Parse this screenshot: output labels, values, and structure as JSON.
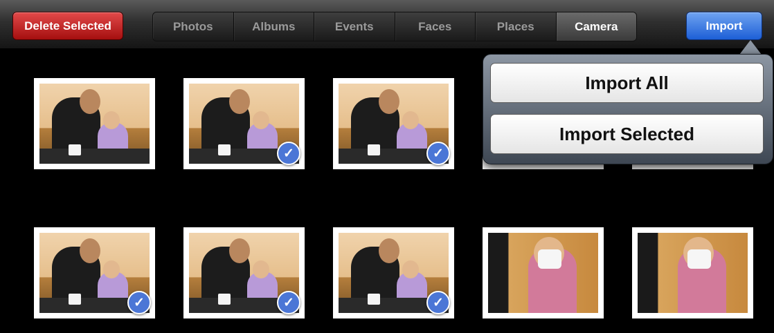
{
  "toolbar": {
    "delete_label": "Delete Selected",
    "import_label": "Import",
    "tabs": [
      {
        "label": "Photos",
        "active": false
      },
      {
        "label": "Albums",
        "active": false
      },
      {
        "label": "Events",
        "active": false
      },
      {
        "label": "Faces",
        "active": false
      },
      {
        "label": "Places",
        "active": false
      },
      {
        "label": "Camera",
        "active": true
      }
    ]
  },
  "popover": {
    "import_all_label": "Import All",
    "import_selected_label": "Import Selected"
  },
  "photos": [
    {
      "kind": "family",
      "selected": false
    },
    {
      "kind": "family",
      "selected": true
    },
    {
      "kind": "family",
      "selected": true
    },
    {
      "kind": "hidden",
      "selected": false
    },
    {
      "kind": "hidden",
      "selected": false
    },
    {
      "kind": "family",
      "selected": true
    },
    {
      "kind": "family",
      "selected": true
    },
    {
      "kind": "family",
      "selected": true
    },
    {
      "kind": "closeup",
      "selected": false
    },
    {
      "kind": "closeup",
      "selected": false
    }
  ],
  "icons": {
    "check": "checkmark-icon"
  },
  "colors": {
    "delete": "#c0161a",
    "import": "#2f6ee0",
    "check": "#4b76d6"
  }
}
